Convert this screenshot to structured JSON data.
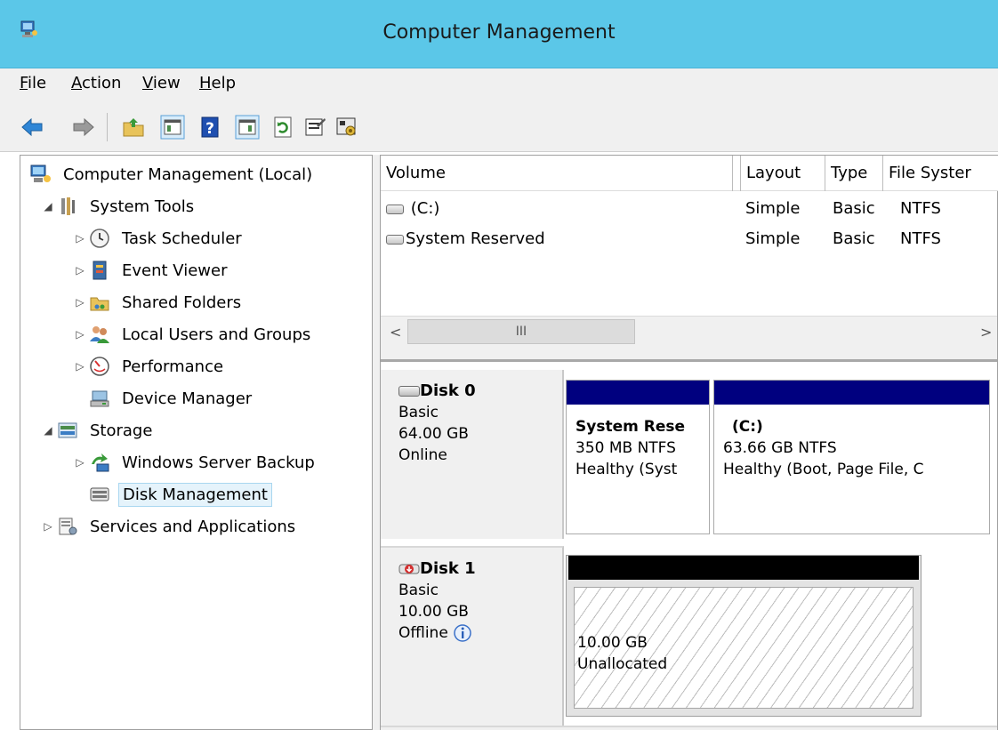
{
  "window": {
    "title": "Computer Management"
  },
  "menu": [
    {
      "label": "File",
      "key": "F",
      "rest": "ile"
    },
    {
      "label": "Action",
      "key": "A",
      "rest": "ction"
    },
    {
      "label": "View",
      "key": "V",
      "rest": "iew"
    },
    {
      "label": "Help",
      "key": "H",
      "rest": "elp"
    }
  ],
  "toolbar": {
    "icons": [
      "back-arrow-icon",
      "forward-arrow-icon",
      "up-folder-icon",
      "show-hide-console-tree-icon",
      "help-icon",
      "show-hide-action-pane-icon",
      "refresh-icon",
      "properties-icon",
      "settings-icon"
    ]
  },
  "tree": {
    "root": "Computer Management (Local)",
    "system_tools": "System Tools",
    "task_scheduler": "Task Scheduler",
    "event_viewer": "Event Viewer",
    "shared_folders": "Shared Folders",
    "local_users": "Local Users and Groups",
    "performance": "Performance",
    "device_manager": "Device Manager",
    "storage": "Storage",
    "wsb": "Windows Server Backup",
    "disk_mgmt": "Disk Management",
    "services": "Services and Applications",
    "expanded_glyph": "◢",
    "collapsed_glyph": "▷"
  },
  "volume_list": {
    "columns": [
      "Volume",
      "Layout",
      "Type",
      "File Syster"
    ],
    "rows": [
      {
        "volume": "(C:)",
        "layout": "Simple",
        "type": "Basic",
        "fs": "NTFS"
      },
      {
        "volume": "System Reserved",
        "layout": "Simple",
        "type": "Basic",
        "fs": "NTFS"
      }
    ],
    "scroll_left": "<",
    "scroll_right": ">",
    "scroll_grip": "III"
  },
  "disks": [
    {
      "name": "Disk 0",
      "type": "Basic",
      "size": "64.00 GB",
      "status": "Online",
      "partitions": [
        {
          "title": "System Rese",
          "detail": "350 MB NTFS",
          "health": "Healthy (Syst"
        },
        {
          "title": "(C:)",
          "detail": "63.66 GB NTFS",
          "health": "Healthy (Boot, Page File, C"
        }
      ]
    },
    {
      "name": "Disk 1",
      "type": "Basic",
      "size": "10.00 GB",
      "status": "Offline",
      "partitions": [
        {
          "detail": "10.00 GB",
          "health": "Unallocated"
        }
      ]
    }
  ],
  "colors": {
    "titlebar": "#5bc7e8",
    "primary_partition": "#00007f",
    "unallocated": "#000000"
  }
}
